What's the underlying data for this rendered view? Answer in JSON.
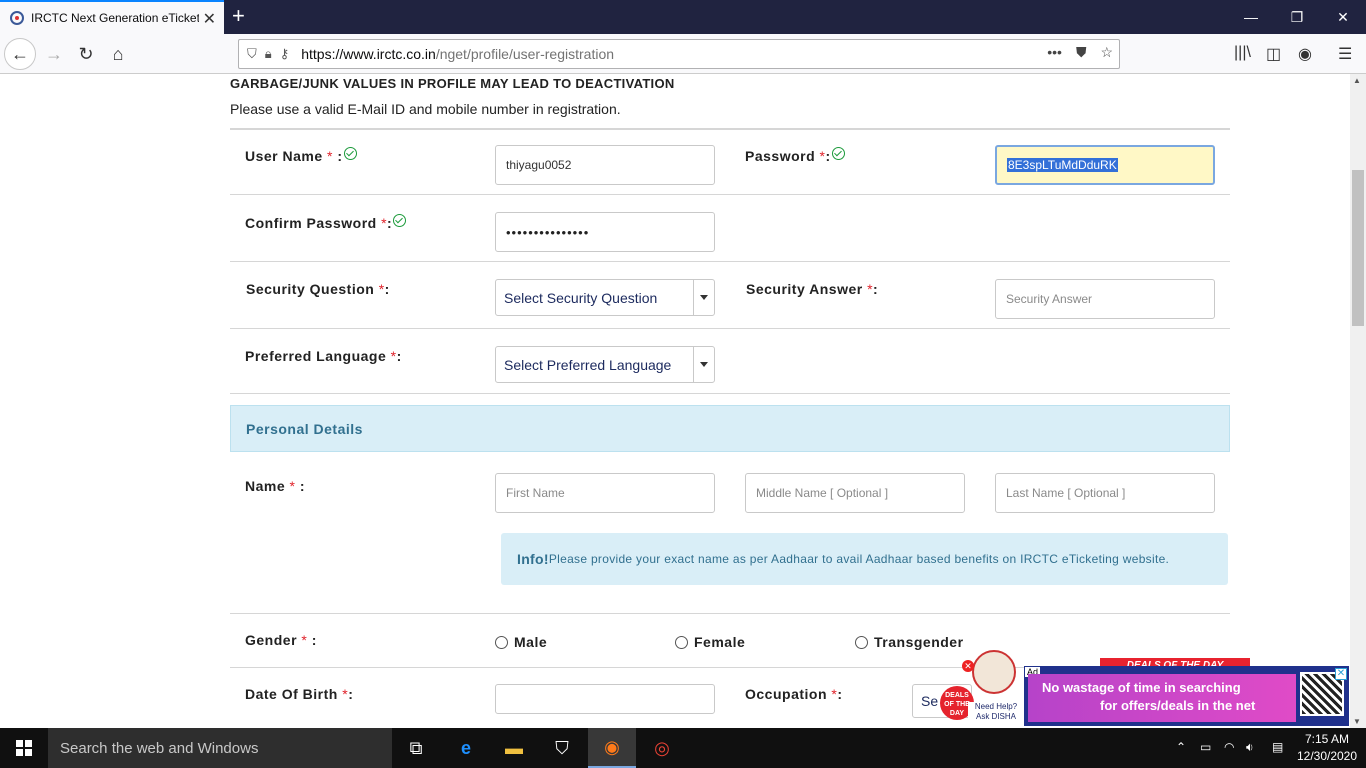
{
  "browser": {
    "tab_title": "IRCTC Next Generation eTicketi",
    "url_host": "https://www.irctc.co.in",
    "url_path": "/nget/profile/user-registration"
  },
  "page": {
    "warning": "GARBAGE/JUNK VALUES IN PROFILE MAY LEAD TO DEACTIVATION",
    "note": "Please use a valid E-Mail ID and mobile number in registration.",
    "required_marker": "*",
    "username_label": "User Name",
    "username_value": "thiyagu0052",
    "password_label": "Password",
    "password_value": "8E3spLTuMdDduRK",
    "confirm_password_label": "Confirm Password",
    "confirm_password_value": "•••••••••••••••",
    "security_question_label": "Security Question",
    "security_question_value": "Select Security Question",
    "security_answer_label": "Security Answer",
    "security_answer_placeholder": "Security Answer",
    "preferred_language_label": "Preferred Language",
    "preferred_language_value": "Select Preferred Language",
    "personal_details_heading": "Personal Details",
    "name_label": "Name",
    "first_name_placeholder": "First Name",
    "middle_name_placeholder": "Middle Name  [ Optional ]",
    "last_name_placeholder": "Last Name  [ Optional ]",
    "info_title": "Info!",
    "info_text": "Please provide your exact name as per Aadhaar to avail Aadhaar based benefits on IRCTC eTicketing website.",
    "gender_label": "Gender",
    "gender_options": [
      "Male",
      "Female",
      "Transgender"
    ],
    "dob_label": "Date Of Birth",
    "occupation_label": "Occupation",
    "occupation_value_partial": "Se"
  },
  "ad": {
    "ad_tag": "Ad",
    "deals_title": "DEALS OF THE DAY",
    "line1": "No wastage of time in searching",
    "line2": "for offers/deals in the net",
    "disha_text": "Need Help? Ask DISHA",
    "sticker_text": "DEALS OF THE DAY"
  },
  "taskbar": {
    "search_placeholder": "Search the web and Windows",
    "time": "7:15 AM",
    "date": "12/30/2020"
  }
}
